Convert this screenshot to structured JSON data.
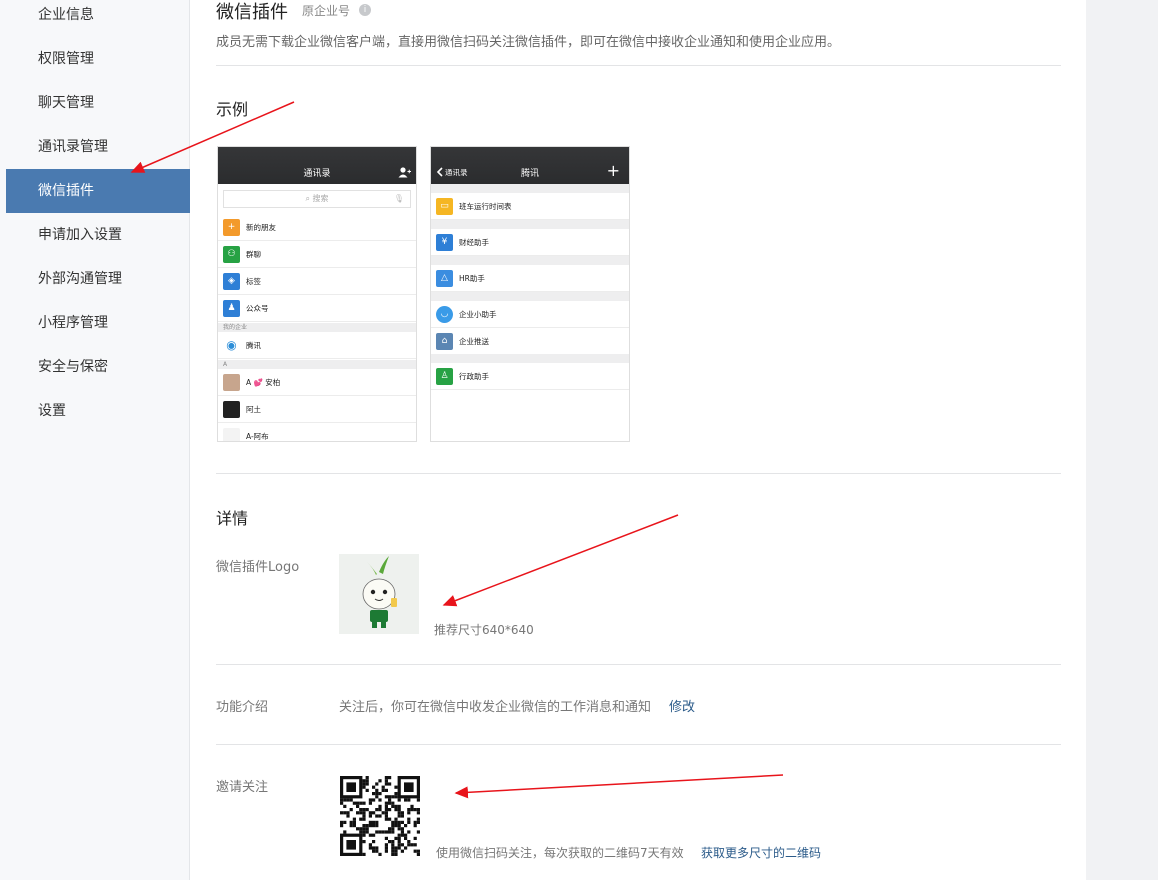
{
  "sidebar": {
    "items": [
      {
        "label": "企业信息",
        "active": false
      },
      {
        "label": "权限管理",
        "active": false
      },
      {
        "label": "聊天管理",
        "active": false
      },
      {
        "label": "通讯录管理",
        "active": false
      },
      {
        "label": "微信插件",
        "active": true
      },
      {
        "label": "申请加入设置",
        "active": false
      },
      {
        "label": "外部沟通管理",
        "active": false
      },
      {
        "label": "小程序管理",
        "active": false
      },
      {
        "label": "安全与保密",
        "active": false
      },
      {
        "label": "设置",
        "active": false
      }
    ]
  },
  "header": {
    "title": "微信插件",
    "subtitle": "原企业号",
    "description": "成员无需下载企业微信客户端，直接用微信扫码关注微信插件，即可在微信中接收企业通知和使用企业应用。"
  },
  "example": {
    "title": "示例",
    "phone1": {
      "title": "通讯录",
      "search_placeholder": "搜索",
      "rows": [
        "新的朋友",
        "群聊",
        "标签",
        "公众号"
      ],
      "section_label": "我的企业",
      "company": "腾讯",
      "group_letter": "A",
      "contacts": [
        "A 💕 安柏",
        "阿土",
        "A-阿布"
      ]
    },
    "phone2": {
      "back_label": "通讯录",
      "title": "腾讯",
      "apps": [
        "班车运行时间表",
        "财经助手",
        "HR助手",
        "企业小助手",
        "企业推送",
        "行政助手"
      ]
    }
  },
  "details": {
    "title": "详情",
    "logo_label": "微信插件Logo",
    "logo_hint": "推荐尺寸640*640",
    "intro_label": "功能介绍",
    "intro_text": "关注后，你可在微信中收发企业微信的工作消息和通知",
    "intro_edit": "修改",
    "invite_label": "邀请关注",
    "invite_text": "使用微信扫码关注，每次获取的二维码7天有效",
    "invite_link": "获取更多尺寸的二维码"
  },
  "colors": {
    "sidebar_active": "#4a7ab0",
    "annotation_arrow": "#e8141b",
    "link": "#2b5b8a"
  }
}
